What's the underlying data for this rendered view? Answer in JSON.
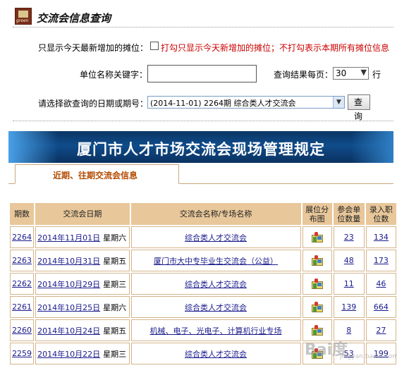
{
  "header": {
    "logo_text": "green",
    "title": "交流会信息查询"
  },
  "form": {
    "new_only_label": "只显示今天最新增加的摊位：",
    "new_only_hint": "打勾只显示今天新增加的摊位；不打勾表示本期所有摊位信息",
    "keyword_label": "单位名称关键字：",
    "keyword_value": "",
    "page_size_label": "查询结果每页：",
    "page_size_value": "30",
    "page_size_unit": "行",
    "date_label": "请选择欲查询的日期或期号：",
    "date_value": "(2014-11-01) 2264期 综合类人才交流会",
    "query_button": "查 询"
  },
  "banner": {
    "text": "厦门市人才市场交流会现场管理规定"
  },
  "tabs": [
    {
      "label": "近期、往期交流会信息",
      "active": true
    }
  ],
  "table": {
    "headers": [
      "期数",
      "交流会日期",
      "交流会名称/专场名称",
      "展位分\n布图",
      "参会单\n位数量",
      "录入职\n位数"
    ],
    "rows": [
      {
        "id": "2264",
        "date": "2014年11月01日",
        "weekday": "星期六",
        "name": "综合类人才交流会",
        "units": "23",
        "positions": "134"
      },
      {
        "id": "2263",
        "date": "2014年10月31日",
        "weekday": "星期五",
        "name": "厦门市大中专毕业生交流会（公益）",
        "units": "48",
        "positions": "173"
      },
      {
        "id": "2262",
        "date": "2014年10月29日",
        "weekday": "星期三",
        "name": "综合类人才交流会",
        "units": "11",
        "positions": "46"
      },
      {
        "id": "2261",
        "date": "2014年10月25日",
        "weekday": "星期六",
        "name": "综合类人才交流会",
        "units": "139",
        "positions": "664"
      },
      {
        "id": "2260",
        "date": "2014年10月24日",
        "weekday": "星期五",
        "name": "机械、电子、光电子、计算机行业专场",
        "units": "8",
        "positions": "27"
      },
      {
        "id": "2259",
        "date": "2014年10月22日",
        "weekday": "星期三",
        "name": "综合类人才交流会",
        "units": "53",
        "positions": "199"
      }
    ]
  },
  "watermark": {
    "main": "Bai度",
    "sub": "jingyan.baidu.com"
  },
  "colors": {
    "header_fill": "#e8c79a",
    "link": "#1a1a8c",
    "hint_red": "#cc0000",
    "tab_text": "#b34a00",
    "banner_blue": "#0f4c8a"
  }
}
